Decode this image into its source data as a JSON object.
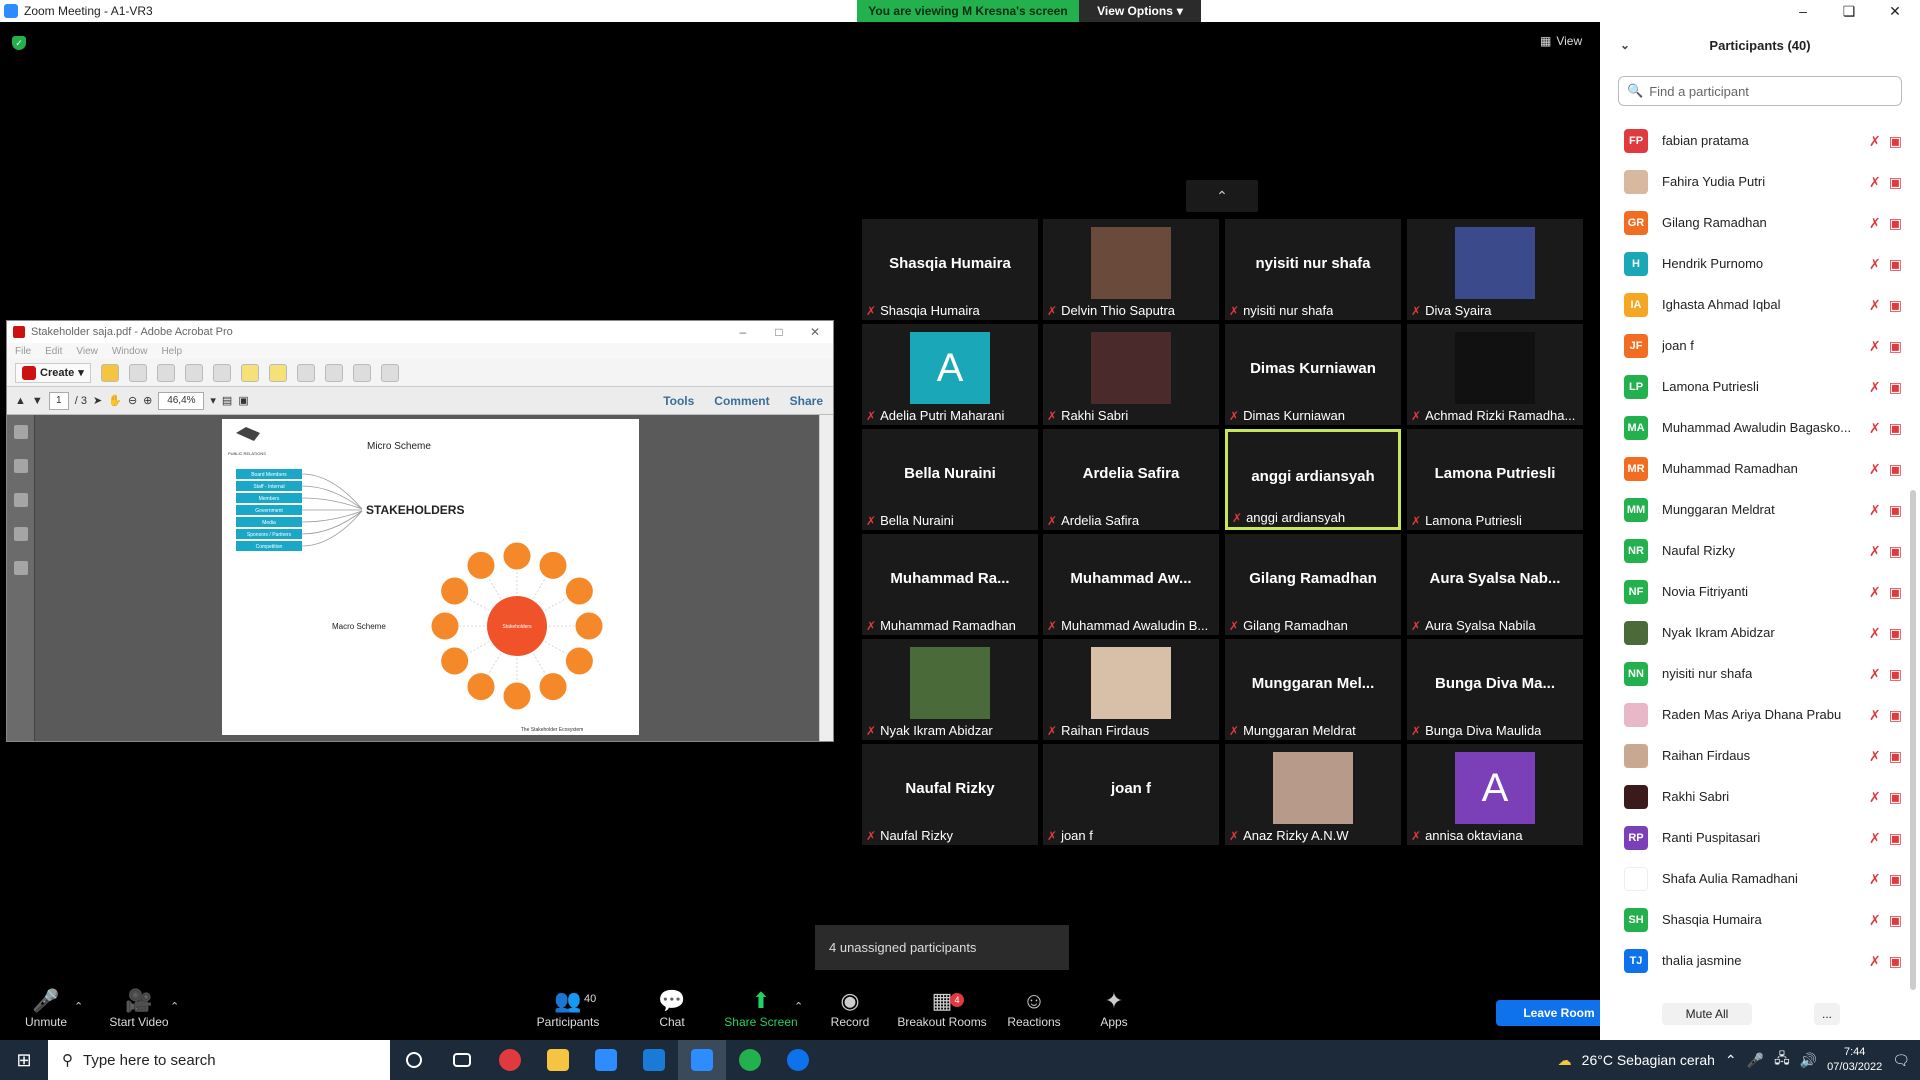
{
  "window": {
    "title": "Zoom Meeting - A1-VR3"
  },
  "banner": {
    "viewing": "You are viewing M Kresna's screen",
    "view_options": "View Options"
  },
  "view_label": "View",
  "acrobat": {
    "title": "Stakeholder saja.pdf - Adobe Acrobat Pro",
    "menu": [
      "File",
      "Edit",
      "View",
      "Window",
      "Help"
    ],
    "create": "Create",
    "page": "1",
    "page_total": "/ 3",
    "zoom": "46,4%",
    "links": [
      "Tools",
      "Comment",
      "Share"
    ],
    "doc": {
      "micro": "Micro Scheme",
      "macro": "Macro Scheme",
      "stakeholders": "STAKEHOLDERS",
      "center": "Stakeholders",
      "logo": "PUBLIC RELATIONS",
      "list": [
        "Board Members",
        "Staff - Internal",
        "Members",
        "Government",
        "Media",
        "Sponsors / Partners",
        "Competition"
      ],
      "footer": "The Stakeholder Ecosystem"
    }
  },
  "tiles": [
    {
      "big": "Shasqia Humaira",
      "label": "Shasqia Humaira"
    },
    {
      "big": "",
      "label": "Delvin Thio Saputra",
      "photo": "#6a4a3a"
    },
    {
      "big": "nyisiti nur shafa",
      "label": "nyisiti nur shafa"
    },
    {
      "big": "",
      "label": "Diva Syaira",
      "photo": "#3a4a8a"
    },
    {
      "big": "",
      "label": "Adelia Putri Maharani",
      "avatar": "A",
      "avcolor": "#1aa8b8"
    },
    {
      "big": "",
      "label": "Rakhi Sabri",
      "photo": "#4a2a2a"
    },
    {
      "big": "Dimas Kurniawan",
      "label": "Dimas Kurniawan"
    },
    {
      "big": "",
      "label": "Achmad Rizki Ramadha...",
      "photo": "#111111"
    },
    {
      "big": "Bella Nuraini",
      "label": "Bella Nuraini"
    },
    {
      "big": "Ardelia Safira",
      "label": "Ardelia Safira"
    },
    {
      "big": "anggi ardiansyah",
      "label": "anggi ardiansyah",
      "active": true
    },
    {
      "big": "Lamona Putriesli",
      "label": "Lamona Putriesli"
    },
    {
      "big": "Muhammad Ra...",
      "label": "Muhammad Ramadhan"
    },
    {
      "big": "Muhammad Aw...",
      "label": "Muhammad Awaludin B..."
    },
    {
      "big": "Gilang Ramadhan",
      "label": "Gilang Ramadhan"
    },
    {
      "big": "Aura Syalsa Nab...",
      "label": "Aura Syalsa Nabila"
    },
    {
      "big": "",
      "label": "Nyak Ikram Abidzar",
      "photo": "#4a6a3a"
    },
    {
      "big": "",
      "label": "Raihan Firdaus",
      "photo": "#d8c0a8"
    },
    {
      "big": "Munggaran Mel...",
      "label": "Munggaran Meldrat"
    },
    {
      "big": "Bunga Diva Ma...",
      "label": "Bunga Diva Maulida"
    },
    {
      "big": "Naufal Rizky",
      "label": "Naufal Rizky"
    },
    {
      "big": "joan f",
      "label": "joan f"
    },
    {
      "big": "",
      "label": "Anaz Rizky A.N.W",
      "photo": "#b89a8a"
    },
    {
      "big": "",
      "label": "annisa oktaviana",
      "avatar": "A",
      "avcolor": "#7b3fb8"
    }
  ],
  "unassigned": "4 unassigned participants",
  "toolbar": {
    "unmute": "Unmute",
    "start_video": "Start Video",
    "participants": "Participants",
    "participants_count": "40",
    "chat": "Chat",
    "share_screen": "Share Screen",
    "record": "Record",
    "breakout": "Breakout Rooms",
    "breakout_badge": "4",
    "reactions": "Reactions",
    "apps": "Apps",
    "leave": "Leave Room"
  },
  "panel": {
    "title": "Participants (40)",
    "search_placeholder": "Find a participant",
    "mute_all": "Mute All",
    "more": "...",
    "participants": [
      {
        "initials": "FP",
        "name": "fabian pratama",
        "color": "#e0393e"
      },
      {
        "initials": "",
        "name": "Fahira Yudia Putri",
        "color": "#d9b8a0"
      },
      {
        "initials": "GR",
        "name": "Gilang Ramadhan",
        "color": "#f26d21"
      },
      {
        "initials": "H",
        "name": "Hendrik Purnomo",
        "color": "#1aa8b8"
      },
      {
        "initials": "IA",
        "name": "Ighasta Ahmad Iqbal",
        "color": "#f5a623"
      },
      {
        "initials": "JF",
        "name": "joan f",
        "color": "#f26d21"
      },
      {
        "initials": "LP",
        "name": "Lamona Putriesli",
        "color": "#23b14d"
      },
      {
        "initials": "MA",
        "name": "Muhammad Awaludin Bagasko...",
        "color": "#23b14d"
      },
      {
        "initials": "MR",
        "name": "Muhammad Ramadhan",
        "color": "#f26d21"
      },
      {
        "initials": "MM",
        "name": "Munggaran Meldrat",
        "color": "#23b14d"
      },
      {
        "initials": "NR",
        "name": "Naufal Rizky",
        "color": "#23b14d"
      },
      {
        "initials": "NF",
        "name": "Novia Fitriyanti",
        "color": "#23b14d"
      },
      {
        "initials": "",
        "name": "Nyak Ikram Abidzar",
        "color": "#4a6a3a"
      },
      {
        "initials": "NN",
        "name": "nyisiti nur shafa",
        "color": "#23b14d"
      },
      {
        "initials": "",
        "name": "Raden Mas Ariya Dhana Prabu",
        "color": "#e8b8c8"
      },
      {
        "initials": "",
        "name": "Raihan Firdaus",
        "color": "#c8a890"
      },
      {
        "initials": "",
        "name": "Rakhi Sabri",
        "color": "#3a1a1a"
      },
      {
        "initials": "RP",
        "name": "Ranti Puspitasari",
        "color": "#7b3fb8"
      },
      {
        "initials": "",
        "name": "Shafa Aulia Ramadhani",
        "color": "#ffffff"
      },
      {
        "initials": "SH",
        "name": "Shasqia Humaira",
        "color": "#23b14d"
      },
      {
        "initials": "TJ",
        "name": "thalia jasmine",
        "color": "#0e72ed"
      }
    ]
  },
  "taskbar": {
    "search_placeholder": "Type here to search",
    "weather": "26°C  Sebagian cerah",
    "time": "7:44",
    "date": "07/03/2022"
  }
}
